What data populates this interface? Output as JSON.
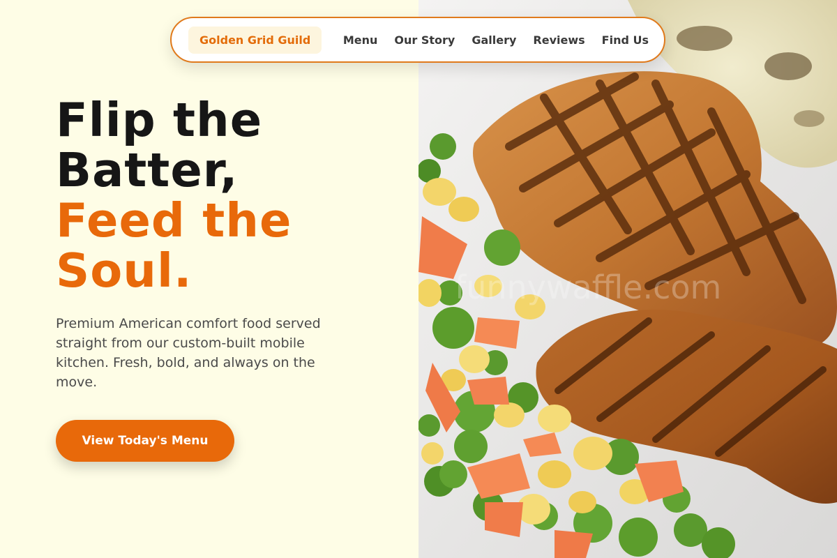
{
  "nav": {
    "brand": "Golden Grid Guild",
    "links": [
      {
        "label": "Menu"
      },
      {
        "label": "Our Story"
      },
      {
        "label": "Gallery"
      },
      {
        "label": "Reviews"
      },
      {
        "label": "Find Us"
      }
    ]
  },
  "hero": {
    "title_line1": "Flip the",
    "title_line2": "Batter,",
    "title_accent_line1": "Feed the",
    "title_accent_line2": "Soul.",
    "subtitle": "Premium American comfort food served straight from our custom-built mobile kitchen. Fresh, bold, and always on the move.",
    "cta_label": "View Today's Menu",
    "image_watermark": "funnywaffle.com"
  },
  "colors": {
    "background": "#fefde6",
    "accent": "#e8690a",
    "heading": "#161616",
    "body_text": "#4a4a4a"
  }
}
